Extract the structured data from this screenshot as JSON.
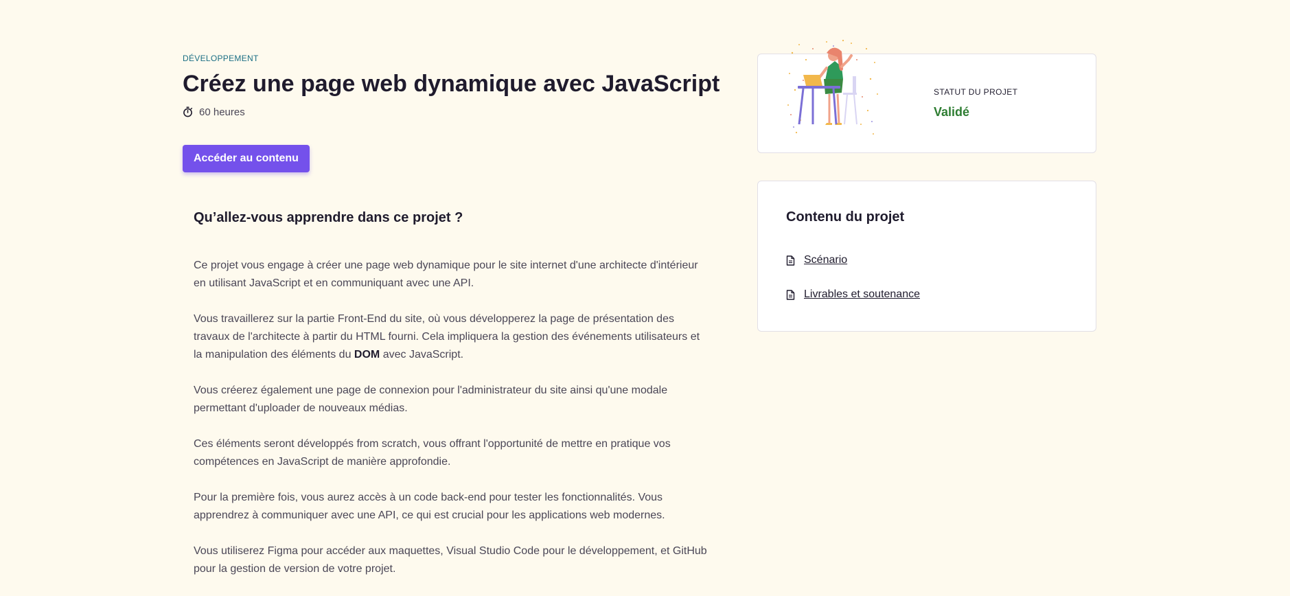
{
  "project": {
    "category": "DÉVELOPPEMENT",
    "title": "Créez une page web dynamique avec JavaScript",
    "duration": "60 heures",
    "cta_label": "Accéder au contenu"
  },
  "learn": {
    "heading": "Qu’allez-vous apprendre dans ce projet ?",
    "paragraphs": [
      "Ce projet vous engage à créer une page web dynamique pour le site internet d'une architecte d'intérieur en utilisant JavaScript et en communiquant avec une API.",
      {
        "before": "Vous travaillerez sur la partie Front-End du site, où vous développerez la page de présentation des travaux de l'architecte à partir du HTML fourni. Cela impliquera la gestion des événements utilisateurs et la manipulation des éléments du ",
        "bold": "DOM",
        "after": " avec JavaScript."
      },
      "Vous créerez également une page de connexion pour l'administrateur du site ainsi qu'une modale permettant d'uploader de nouveaux médias.",
      "Ces éléments seront développés from scratch, vous offrant l'opportunité de mettre en pratique vos compétences en JavaScript de manière approfondie.",
      "Pour la première fois, vous aurez accès à un code back-end pour tester les fonctionnalités. Vous apprendrez à communiquer avec une API, ce qui est crucial pour les applications web modernes.",
      "Vous utiliserez Figma pour accéder aux maquettes, Visual Studio Code pour le développement, et GitHub pour la gestion de version de votre projet."
    ]
  },
  "status": {
    "label": "STATUT DU PROJET",
    "value": "Validé",
    "value_color": "#2e7d32"
  },
  "content": {
    "title": "Contenu du projet",
    "items": [
      {
        "label": "Scénario",
        "icon": "document-icon"
      },
      {
        "label": "Livrables et soutenance",
        "icon": "document-icon"
      }
    ]
  },
  "colors": {
    "background": "#fefaee",
    "accent": "#7451eb",
    "category": "#1a6e84",
    "text": "#1f1b2d"
  }
}
